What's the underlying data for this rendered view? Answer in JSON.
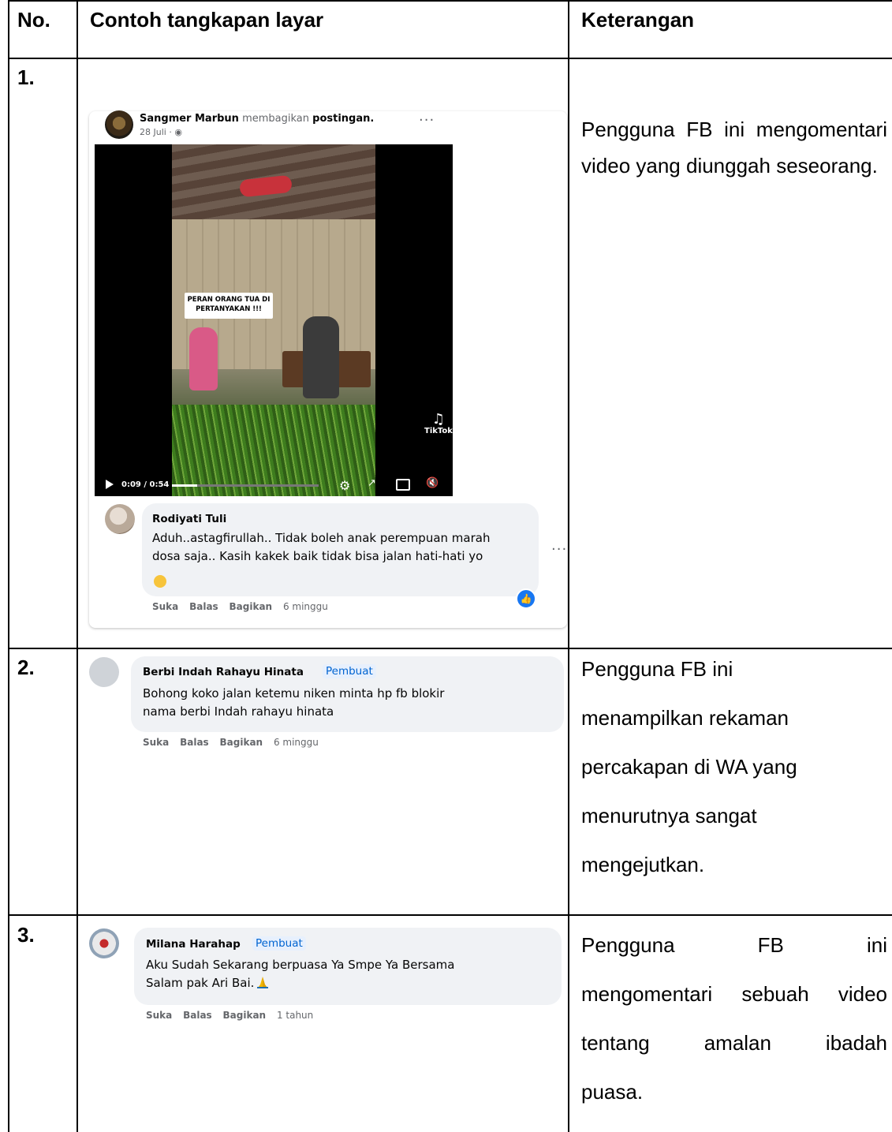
{
  "table": {
    "headers": [
      "No.",
      "Contoh tangkapan layar",
      "Keterangan"
    ],
    "rows": [
      {
        "no": "1.",
        "desc": [
          "Pengguna FB ini mengomentari video yang diunggah seseorang."
        ]
      },
      {
        "no": "2.",
        "desc": [
          "Pengguna FB ini",
          "menampilkan rekaman",
          "percakapan di WA yang",
          "menurutnya sangat",
          "mengejutkan."
        ]
      },
      {
        "no": "3.",
        "desc": [
          "Pengguna FB ini",
          "mengomentari sebuah video",
          "tentang amalan ibadah",
          "puasa."
        ]
      }
    ]
  },
  "post": {
    "author": "Sangmer Marbun",
    "action": "membagikan",
    "object": "postingan.",
    "date": "28 Juli · ",
    "more_icon": "more-horizontal-icon",
    "video": {
      "caption_line1": "PERAN ORANG TUA DI",
      "caption_line2": "PERTANYAKAN !!!",
      "watermark": "TikTok",
      "time": "0:09 / 0:54",
      "progress": 0.17
    }
  },
  "comments": [
    {
      "name": "Rodiyati Tuli",
      "lines": [
        "Aduh..astagfirullah.. Tidak boleh anak perempuan marah",
        "dosa saja.. Kasih kakek baik tidak bisa jalan hati-hati yo"
      ],
      "emoji": "sad-face-emoji",
      "actions": [
        "Suka",
        "Balas",
        "Bagikan"
      ],
      "age": "6 minggu"
    },
    {
      "name": "Berbi Indah Rahayu Hinata",
      "badge": "Pembuat",
      "lines": [
        "Bohong koko jalan ketemu niken minta hp fb blokir",
        "nama berbi Indah rahayu hinata"
      ],
      "actions": [
        "Suka",
        "Balas",
        "Bagikan"
      ],
      "age": "6 minggu"
    },
    {
      "name": "Milana Harahap",
      "badge": "Pembuat",
      "lines": [
        "Aku Sudah Sekarang berpuasa Ya Smpe Ya Bersama",
        "Salam pak Ari Bai."
      ],
      "emoji": "praying-hands-emoji",
      "actions": [
        "Suka",
        "Balas",
        "Bagikan"
      ],
      "age": "1 tahun"
    }
  ],
  "colors": {
    "link": "#0064d1",
    "bubble": "#f0f2f5",
    "muted": "#65676b"
  }
}
